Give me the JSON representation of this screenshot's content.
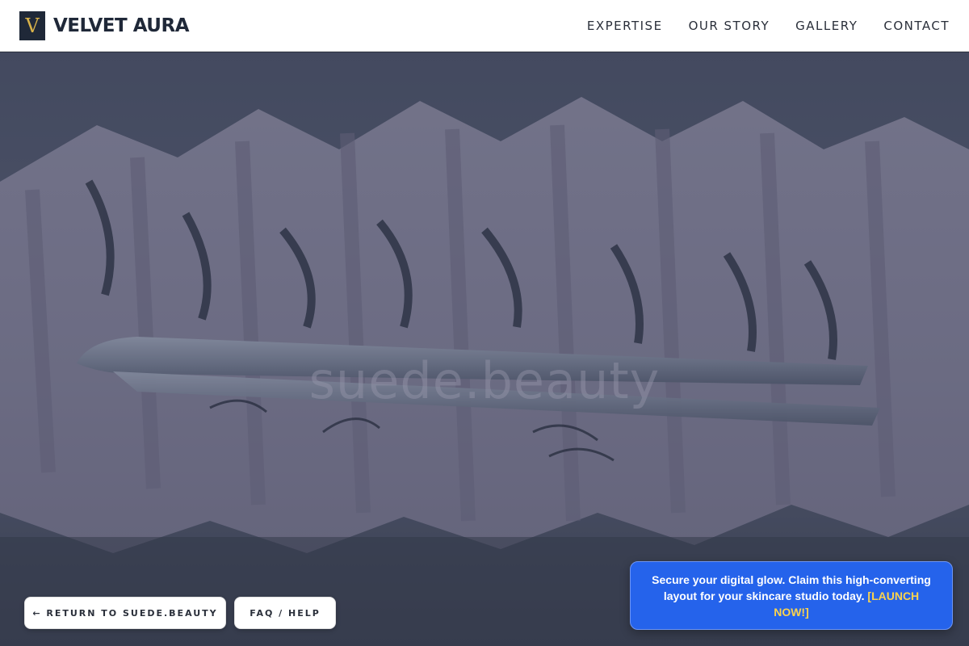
{
  "header": {
    "logo_letter": "V",
    "brand_name": "VELVET AURA",
    "nav": [
      {
        "label": "EXPERTISE"
      },
      {
        "label": "OUR STORY"
      },
      {
        "label": "GALLERY"
      },
      {
        "label": "CONTACT"
      }
    ]
  },
  "hero": {
    "image_subject": "eyelash-extension-tray-and-tweezers",
    "watermark": "suede.beauty"
  },
  "footer_buttons": {
    "return_label": "← RETURN TO SUEDE.BEAUTY",
    "faq_label": "FAQ / HELP"
  },
  "promo": {
    "text": "Secure your digital glow. Claim this high-converting layout for your skincare studio today.",
    "cta": "[LAUNCH NOW!]"
  },
  "colors": {
    "brand_dark": "#1f2838",
    "logo_gold": "#d8b24a",
    "promo_blue": "#2563eb",
    "promo_cta": "#fbd34d"
  }
}
